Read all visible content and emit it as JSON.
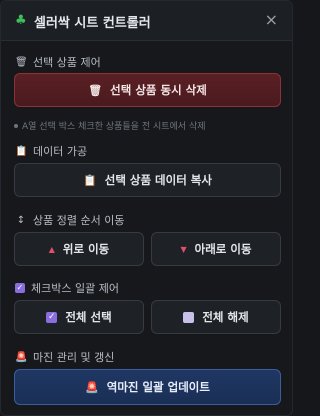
{
  "header": {
    "logo_icon": "clover-icon",
    "title": "셀러싹 시트 컨트롤러",
    "close_glyph": "×"
  },
  "sections": {
    "select_control": {
      "label": "선택 상품 제어",
      "icon": "trash-icon",
      "delete_button": "선택 상품 동시 삭제",
      "hint": "A열 선택 박스 체크한 상품들을 전 시트에서 삭제"
    },
    "data_processing": {
      "label": "데이터 가공",
      "icon": "clipboard-icon",
      "copy_button": "선택 상품 데이터 복사"
    },
    "sort_order": {
      "label": "상품 정렬 순서 이동",
      "icon": "updown-icon",
      "up_button": "위로 이동",
      "down_button": "아래로 이동"
    },
    "checkbox_bulk": {
      "label": "체크박스 일괄 제어",
      "icon": "checkbox-icon",
      "select_all_button": "전체 선택",
      "deselect_all_button": "전체 해제"
    },
    "margin": {
      "label": "마진 관리 및 갱신",
      "icon": "siren-icon",
      "update_button": "역마진 일괄 업데이트"
    }
  },
  "colors": {
    "background": "#16181c",
    "danger": "#5a2024",
    "primary": "#1f3763",
    "accent_purple": "#8a6ee0",
    "logo_green": "#3fbf5a"
  }
}
